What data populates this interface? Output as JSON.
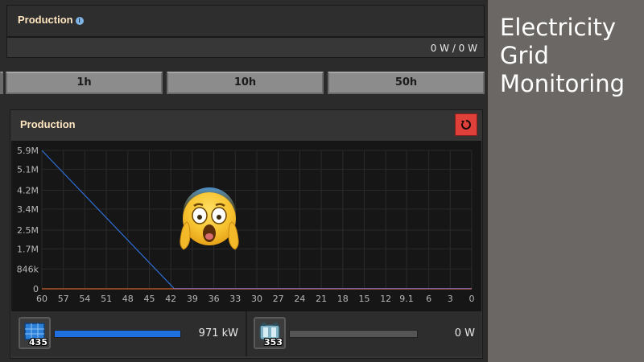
{
  "panel": {
    "title": "Production",
    "info_icon": "info-icon",
    "usage_text": "0 W / 0 W"
  },
  "tabs": [
    {
      "label": "1h"
    },
    {
      "label": "10h"
    },
    {
      "label": "50h"
    }
  ],
  "graph_panel": {
    "title": "Production",
    "reset_icon": "reset-icon"
  },
  "chart_data": {
    "type": "line",
    "y_tick_labels": [
      "5.9M",
      "5.1M",
      "4.2M",
      "3.4M",
      "2.5M",
      "1.7M",
      "846k",
      "0"
    ],
    "y_ticks": [
      5900000,
      5100000,
      4200000,
      3400000,
      2500000,
      1700000,
      846000,
      0
    ],
    "x_tick_labels": [
      "60",
      "57",
      "54",
      "51",
      "48",
      "45",
      "42",
      "39",
      "36",
      "33",
      "30",
      "27",
      "24",
      "21",
      "18",
      "15",
      "12",
      "9.1",
      "6",
      "3",
      "0"
    ],
    "x_ticks": [
      60,
      57,
      54,
      51,
      48,
      45,
      42,
      39,
      36,
      33,
      30,
      27,
      24,
      21,
      18,
      15,
      12,
      9.1,
      6,
      3,
      0
    ],
    "xlim": [
      60,
      0
    ],
    "ylim": [
      0,
      5900000
    ],
    "grid": true,
    "series": [
      {
        "color": "#2f6fd6",
        "x": [
          60,
          41.5,
          0
        ],
        "y": [
          5900000,
          0,
          0
        ]
      },
      {
        "color": "#d0642a",
        "x": [
          60,
          0
        ],
        "y": [
          0,
          0
        ]
      }
    ]
  },
  "overlay": {
    "emoji_icon": "screaming-face-emoji"
  },
  "entities": [
    {
      "icon": "solar-panel-icon",
      "count": "435",
      "value": "971 kW",
      "fill": 1.0,
      "bar_color": "#1f6fe0"
    },
    {
      "icon": "accumulator-icon",
      "count": "353",
      "value": "0 W",
      "fill": 0.0,
      "bar_color": "#1f6fe0"
    }
  ],
  "side_caption": {
    "lines": [
      "Electricity",
      "Grid",
      "Monitoring"
    ]
  }
}
